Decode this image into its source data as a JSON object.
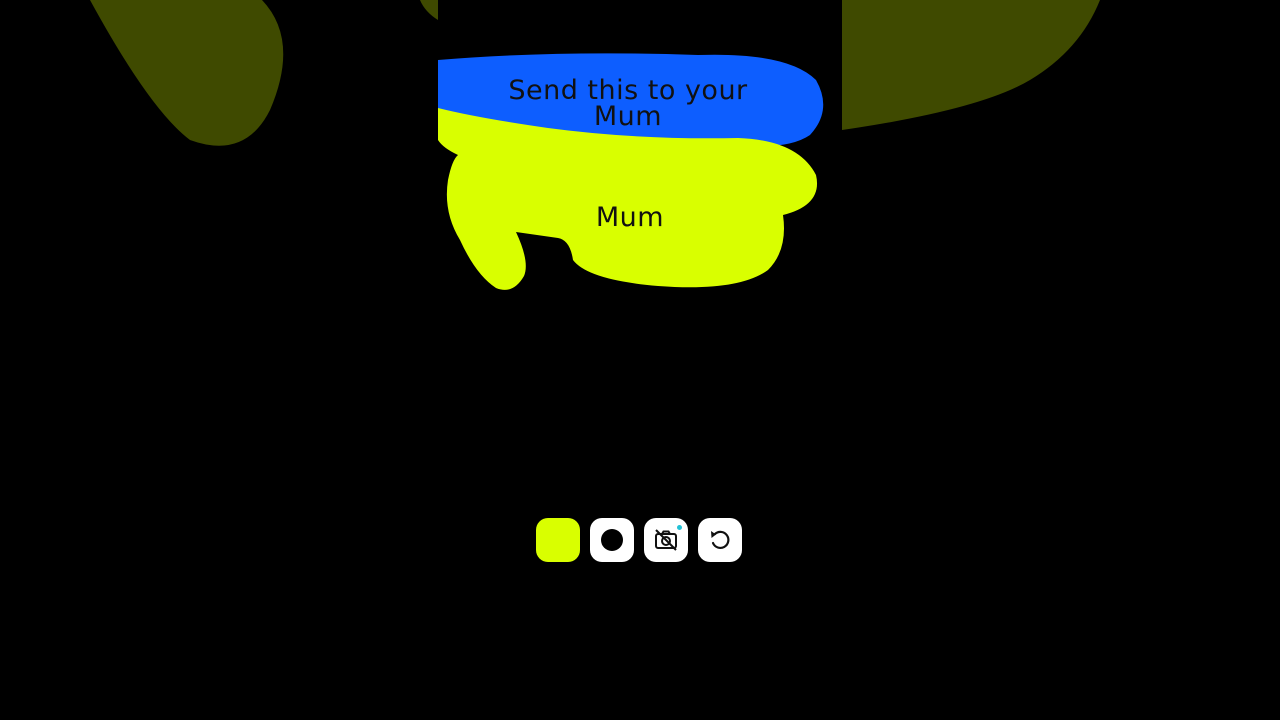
{
  "note": {
    "top_text": "Send this to your Mum",
    "bottom_text": "Mum"
  },
  "toolbar": {
    "buttons": [
      {
        "name": "color-swatch-button",
        "icon": "yellow-swatch",
        "color": "#d9ff00"
      },
      {
        "name": "brush-size-button",
        "icon": "circle-brush-icon"
      },
      {
        "name": "camera-toggle-button",
        "icon": "camera-off-icon"
      },
      {
        "name": "undo-button",
        "icon": "undo-icon"
      }
    ]
  },
  "colors": {
    "blue_stroke": "#0d5eff",
    "yellow_stroke": "#d9ff00",
    "background": "#000000",
    "blurred_olive": "#3f4a00"
  }
}
